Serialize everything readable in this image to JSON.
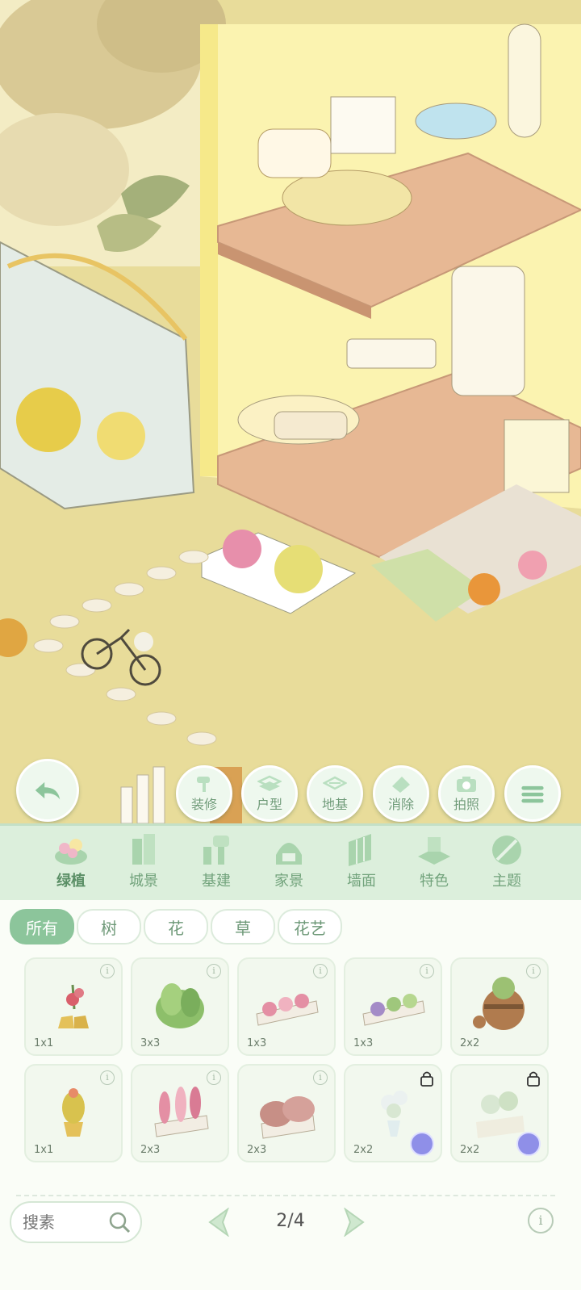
{
  "toolbar": {
    "back_icon": "back-arrow-icon",
    "buttons": [
      {
        "label": "装修",
        "icon": "paint-roller-icon"
      },
      {
        "label": "户型",
        "icon": "floorplan-icon"
      },
      {
        "label": "地基",
        "icon": "foundation-icon"
      },
      {
        "label": "消除",
        "icon": "eraser-icon"
      },
      {
        "label": "拍照",
        "icon": "camera-icon"
      },
      {
        "label": "",
        "icon": "menu-icon"
      }
    ]
  },
  "categories": [
    {
      "label": "绿植",
      "icon": "plant-icon",
      "active": true
    },
    {
      "label": "城景",
      "icon": "city-icon"
    },
    {
      "label": "基建",
      "icon": "construction-icon"
    },
    {
      "label": "家景",
      "icon": "home-icon"
    },
    {
      "label": "墙面",
      "icon": "wall-icon"
    },
    {
      "label": "特色",
      "icon": "feature-icon"
    },
    {
      "label": "主题",
      "icon": "theme-icon"
    }
  ],
  "filters": [
    {
      "label": "所有",
      "active": true
    },
    {
      "label": "树"
    },
    {
      "label": "花"
    },
    {
      "label": "草"
    },
    {
      "label": "花艺"
    }
  ],
  "items": [
    {
      "size": "1x1",
      "icon": "flower-boots-icon",
      "locked": false
    },
    {
      "size": "3x3",
      "icon": "leafy-plant-icon",
      "locked": false
    },
    {
      "size": "1x3",
      "icon": "pink-flowerbed-icon",
      "locked": false
    },
    {
      "size": "1x3",
      "icon": "succulent-planter-icon",
      "locked": false
    },
    {
      "size": "2x2",
      "icon": "barrel-planter-icon",
      "locked": false
    },
    {
      "size": "1x1",
      "icon": "yellow-plant-pot-icon",
      "locked": false
    },
    {
      "size": "2x3",
      "icon": "pink-snapdragon-planter-icon",
      "locked": false
    },
    {
      "size": "2x3",
      "icon": "pink-shrub-planter-icon",
      "locked": false
    },
    {
      "size": "2x2",
      "icon": "white-flower-vase-icon",
      "locked": true
    },
    {
      "size": "2x2",
      "icon": "white-flower-crate-icon",
      "locked": true
    }
  ],
  "search": {
    "placeholder": "搜素"
  },
  "pager": {
    "text": "2/4",
    "current": 2,
    "total": 4
  },
  "colors": {
    "accent": "#8cc59b",
    "bar": "#dcefdc",
    "card": "#f2f8ee",
    "scene_ground": "#e8dc9a"
  }
}
